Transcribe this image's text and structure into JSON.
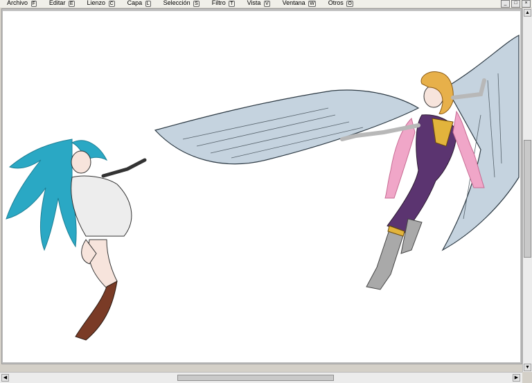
{
  "menu": [
    {
      "label": "Archivo",
      "key": "F"
    },
    {
      "label": "Editar",
      "key": "E"
    },
    {
      "label": "Lienzo",
      "key": "C"
    },
    {
      "label": "Capa",
      "key": "L"
    },
    {
      "label": "Selección",
      "key": "S"
    },
    {
      "label": "Filtro",
      "key": "T"
    },
    {
      "label": "Vista",
      "key": "V"
    },
    {
      "label": "Ventana",
      "key": "W"
    },
    {
      "label": "Otros",
      "key": "O"
    }
  ],
  "window_controls": [
    "minimize-icon",
    "restore-icon",
    "close-icon"
  ],
  "icons": {
    "scroll_up": "▲",
    "scroll_down": "▼",
    "scroll_left": "◀",
    "scroll_right": "▶"
  },
  "colors": {
    "canvas_bg": "#ffffff",
    "frame_bg": "#d4d0c8",
    "hair_left": "#2aa8c4",
    "wing": "#c5d3df",
    "suit": "#5b3470",
    "scarf": "#f0a6c8",
    "boot": "#7a3b26",
    "dress": "#ededed"
  },
  "scroll": {
    "vertical_position": 0.37,
    "horizontal_position": 0.34
  }
}
